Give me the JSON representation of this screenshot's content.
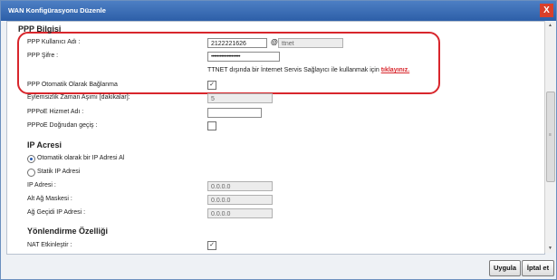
{
  "window": {
    "title": "WAN Konfigürasyonu Düzenle",
    "close_label": "X"
  },
  "ppp": {
    "heading": "PPP Bilgisi",
    "username_label": "PPP Kullanıcı Adı :",
    "username_value": "2122221626",
    "at_sign": "@",
    "domain_value": "ttnet",
    "password_label": "PPP Şifre :",
    "password_value": "••••••••••••••••••••",
    "note_text": "TTNET dışında bir İnternet Servis Sağlayıcı ile kullanmak için",
    "note_link": "tıklayınız.",
    "auto_connect_label": "PPP Otomatik Olarak Bağlanma",
    "auto_connect_checked": true,
    "idle_label": "Eylemsizlik Zaman Aşımı [dakikalar]:",
    "idle_value": "5",
    "pppoe_service_label": "PPPoE Hizmet Adı :",
    "pppoe_service_value": "",
    "pppoe_passthrough_label": "PPPoE Doğrudan geçiş :",
    "pppoe_passthrough_checked": false
  },
  "ip": {
    "heading": "IP Acresi",
    "auto_label": "Otomatik olarak bir IP Adresi Al",
    "static_label": "Statik IP Adresi",
    "selected": "auto",
    "ip_label": "IP Adresi :",
    "ip_value": "0.0.0.0",
    "mask_label": "Alt Ağ Maskesi :",
    "mask_value": "0.0.0.0",
    "gateway_label": "Ağ Geçidi IP Adresi :",
    "gateway_value": "0.0.0.0"
  },
  "routing": {
    "heading": "Yönlendirme Özelliği",
    "nat_label": "NAT Etkinleştir :",
    "nat_checked": true
  },
  "footer": {
    "apply_label": "Uygula",
    "cancel_label": "İptal et"
  },
  "scrollbar": {
    "up": "▲",
    "down": "▼",
    "grip": "≡"
  }
}
